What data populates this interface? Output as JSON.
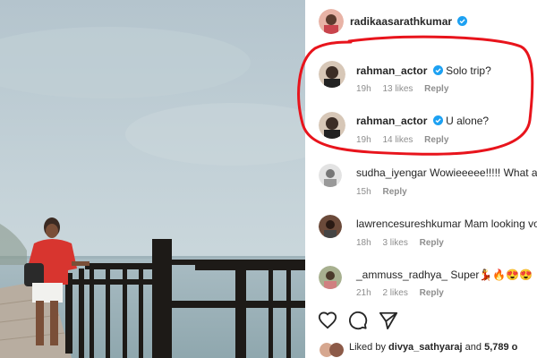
{
  "post": {
    "author": "radikaasarathkumar"
  },
  "comments": [
    {
      "user": "rahman_actor",
      "text": "Solo trip?",
      "time": "19h",
      "likes": "13 likes",
      "reply": "Reply",
      "verified": true
    },
    {
      "user": "rahman_actor",
      "text": "U alone?",
      "time": "19h",
      "likes": "14 likes",
      "reply": "Reply",
      "verified": true
    },
    {
      "user": "sudha_iyengar",
      "text": "Wowieeeee!!!!! What ar",
      "time": "15h",
      "likes": "",
      "reply": "Reply",
      "verified": false
    },
    {
      "user": "lawrencesureshkumar",
      "text": "Mam looking vo",
      "time": "18h",
      "likes": "3 likes",
      "reply": "Reply",
      "verified": false
    },
    {
      "user": "_ammuss_radhya_",
      "text": "Super💃🔥😍😍",
      "time": "21h",
      "likes": "2 likes",
      "reply": "Reply",
      "verified": false
    }
  ],
  "liked_by": {
    "prefix": "Liked by",
    "user": "divya_sathyaraj",
    "and": "and",
    "count": "5,789 o"
  },
  "icons": [
    "heart-icon",
    "comment-icon",
    "share-icon",
    "verified-badge-icon"
  ],
  "colors": {
    "verified": "#1da1f2",
    "annotation": "#e8141c",
    "muted": "#8e8e8e"
  }
}
